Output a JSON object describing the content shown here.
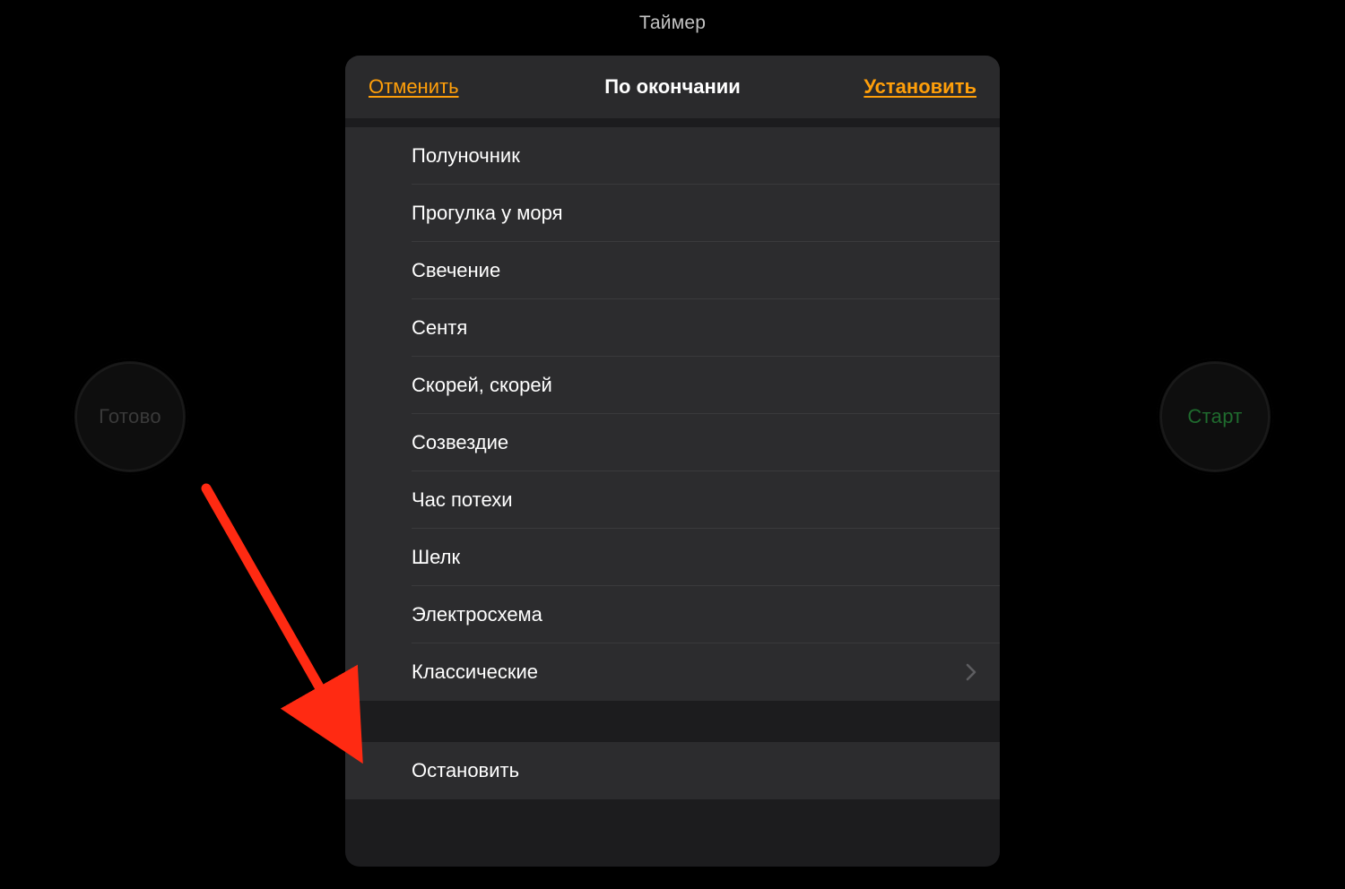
{
  "page": {
    "title": "Таймер"
  },
  "background_buttons": {
    "left_label": "Готово",
    "right_label": "Старт"
  },
  "sheet": {
    "cancel": "Отменить",
    "title": "По окончании",
    "confirm": "Установить",
    "sounds": [
      "Полуночник",
      "Прогулка у моря",
      "Свечение",
      "Сентя",
      "Скорей, скорей",
      "Созвездие",
      "Час потехи",
      "Шелк",
      "Электросхема"
    ],
    "classic_label": "Классические",
    "stop_label": "Остановить"
  }
}
